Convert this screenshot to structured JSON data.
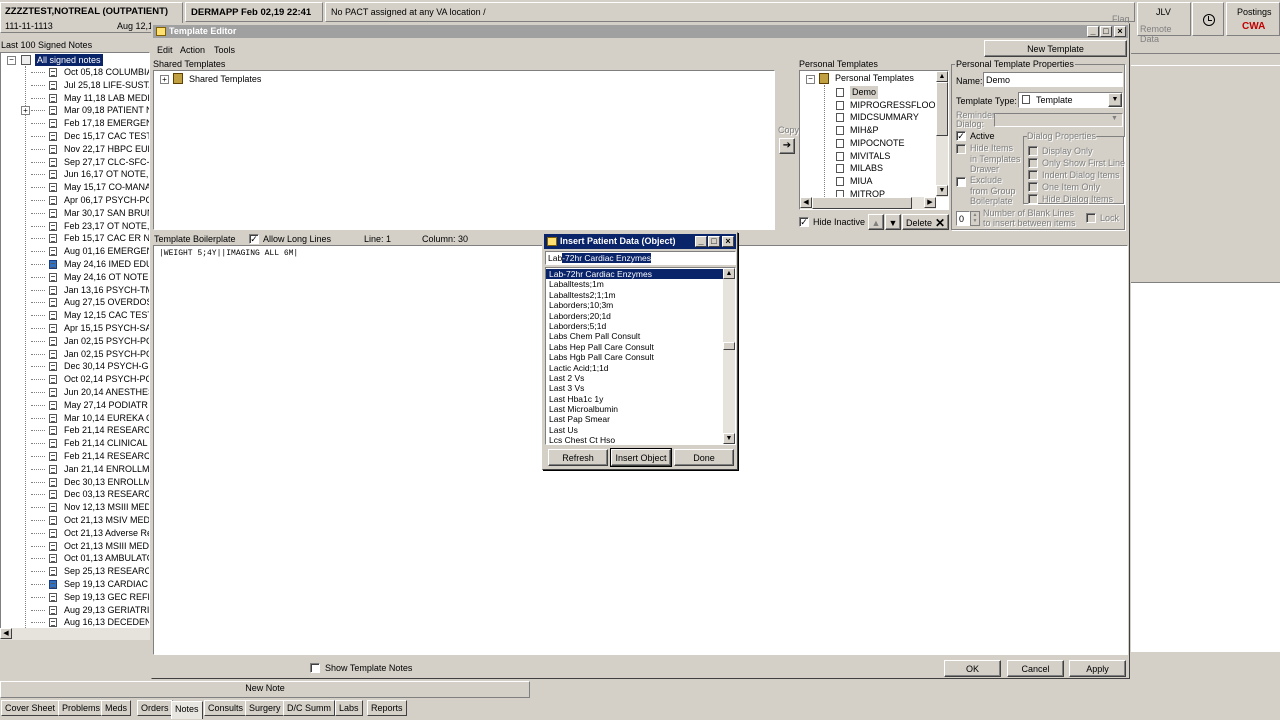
{
  "header": {
    "patient_name": "ZZZZTEST,NOTREAL (OUTPATIENT)",
    "patient_id": "111-11-1113",
    "patient_dob": "Aug 12,1",
    "location": "DERMAPP Feb 02,19 22:41",
    "pact": "No PACT assigned at any VA location /",
    "flag": "Flag",
    "jlv": "JLV",
    "remote_data": "Remote Data",
    "postings": "Postings",
    "cwa": "CWA"
  },
  "notes_panel": {
    "title": "Last 100 Signed Notes",
    "root": "All signed notes",
    "new_note_button": "New Note",
    "items": [
      {
        "text": "Oct 05,18 COLUMBIA",
        "icon": "doc"
      },
      {
        "text": "Jul 25,18 LIFE-SUSTA",
        "icon": "doc"
      },
      {
        "text": "May 11,18 LAB MEDI",
        "icon": "doc"
      },
      {
        "text": "Mar 09,18 PATIENT N",
        "icon": "group"
      },
      {
        "text": "Feb 17,18 EMERGEN",
        "icon": "doc"
      },
      {
        "text": "Dec 15,17 CAC TEST",
        "icon": "doc"
      },
      {
        "text": "Nov 22,17 HBPC EUF",
        "icon": "doc"
      },
      {
        "text": "Sep 27,17 CLC-SFC-F",
        "icon": "doc"
      },
      {
        "text": "Jun 16,17 OT NOTE,",
        "icon": "doc"
      },
      {
        "text": "May 15,17 CO-MANA",
        "icon": "doc"
      },
      {
        "text": "Apr 06,17 PSYCH-PC",
        "icon": "doc"
      },
      {
        "text": "Mar 30,17 SAN BRUN",
        "icon": "doc"
      },
      {
        "text": "Feb 23,17 OT NOTE,",
        "icon": "doc"
      },
      {
        "text": "Feb 15,17 CAC ER NU",
        "icon": "doc"
      },
      {
        "text": "Aug 01,16 EMERGEN",
        "icon": "doc"
      },
      {
        "text": "May 24,16 IMED EDU",
        "icon": "blue"
      },
      {
        "text": "May 24,16 OT NOTE,",
        "icon": "doc"
      },
      {
        "text": "Jan 13,16 PSYCH-TM",
        "icon": "doc"
      },
      {
        "text": "Aug 27,15 OVERDOS",
        "icon": "doc"
      },
      {
        "text": "May 12,15 CAC TEST",
        "icon": "doc"
      },
      {
        "text": "Apr 15,15 PSYCH-SA",
        "icon": "doc"
      },
      {
        "text": "Jan 02,15 PSYCH-PC",
        "icon": "doc"
      },
      {
        "text": "Jan 02,15 PSYCH-PC",
        "icon": "doc"
      },
      {
        "text": "Dec 30,14 PSYCH-GF",
        "icon": "doc"
      },
      {
        "text": "Oct 02,14 PSYCH-PC",
        "icon": "doc"
      },
      {
        "text": "Jun 20,14 ANESTHES",
        "icon": "doc"
      },
      {
        "text": "May 27,14 PODIATR",
        "icon": "doc"
      },
      {
        "text": "Mar 10,14 EUREKA C",
        "icon": "doc"
      },
      {
        "text": "Feb 21,14 RESEARCI",
        "icon": "doc"
      },
      {
        "text": "Feb 21,14 CLINICAL I",
        "icon": "doc"
      },
      {
        "text": "Feb 21,14 RESEARCI",
        "icon": "doc"
      },
      {
        "text": "Jan 21,14 ENROLLMI",
        "icon": "doc"
      },
      {
        "text": "Dec 30,13 ENROLLM",
        "icon": "doc"
      },
      {
        "text": "Dec 03,13 RESEARC",
        "icon": "doc"
      },
      {
        "text": "Nov 12,13 MSIII MED",
        "icon": "doc"
      },
      {
        "text": "Oct 21,13 MSIV MED",
        "icon": "doc"
      },
      {
        "text": "Oct 21,13 Adverse Re",
        "icon": "doc"
      },
      {
        "text": "Oct 21,13 MSIII MEDI",
        "icon": "doc"
      },
      {
        "text": "Oct 01,13 AMBULATO",
        "icon": "doc"
      },
      {
        "text": "Sep 25,13 RESEARC",
        "icon": "doc"
      },
      {
        "text": "Sep 19,13 CARDIAC (",
        "icon": "blue"
      },
      {
        "text": "Sep 19,13 GEC REFE",
        "icon": "doc"
      },
      {
        "text": "Aug 29,13 GERIATRI",
        "icon": "doc"
      },
      {
        "text": "Aug 16,13 DECEDEN",
        "icon": "doc"
      }
    ]
  },
  "tabs": [
    "Cover Sheet",
    "Problems",
    "Meds",
    "Orders",
    "Notes",
    "Consults",
    "Surgery",
    "D/C Summ",
    "Labs",
    "Reports"
  ],
  "template_editor": {
    "title": "Template Editor",
    "menu": [
      "Edit",
      "Action",
      "Tools"
    ],
    "new_template_button": "New Template",
    "shared_label": "Shared Templates",
    "shared_root": "Shared Templates",
    "personal_label": "Personal Templates",
    "personal_root": "Personal Templates",
    "personal_items": [
      "Demo",
      "MIPROGRESSFLOOR",
      "MIDCSUMMARY",
      "MIH&P",
      "MIPOCNOTE",
      "MIVITALS",
      "MILABS",
      "MIUA",
      "MITROP"
    ],
    "copy_label": "Copy",
    "hide_inactive": "Hide Inactive",
    "delete_button": "Delete",
    "properties": {
      "group_title": "Personal Template Properties",
      "name_label": "Name:",
      "name_value": "Demo",
      "type_label": "Template Type:",
      "type_value": "Template",
      "reminder_label": "Reminder Dialog:",
      "active_label": "Active",
      "hide_items_label": "Hide Items in Templates Drawer",
      "exclude_label": "Exclude from Group Boilerplate",
      "dialog_props_title": "Dialog Properties",
      "display_only": "Display Only",
      "only_show_first": "Only Show First Line",
      "indent_items": "Indent Dialog Items",
      "one_item_only": "One Item Only",
      "hide_dialog_items": "Hide Dialog Items",
      "blank_lines_value": "0",
      "blank_lines_label": "Number of Blank Lines to insert between items",
      "lock_label": "Lock"
    },
    "boilerplate": {
      "label": "Template Boilerplate",
      "allow_long_lines": "Allow Long Lines",
      "line": "Line: 1",
      "column": "Column: 30",
      "text": "|WEIGHT 5;4Y||IMAGING ALL 6M|"
    },
    "show_notes": "Show Template Notes",
    "ok_button": "OK",
    "cancel_button": "Cancel",
    "apply_button": "Apply"
  },
  "insert_dialog": {
    "title": "Insert Patient Data (Object)",
    "search_prefix": "Lab",
    "search_selected": "-72hr Cardiac Enzymes",
    "items": [
      "Lab-72hr Cardiac Enzymes",
      "Laballtests;1m",
      "Laballtests2;1;1m",
      "Laborders;10;3m",
      "Laborders;20;1d",
      "Laborders;5;1d",
      "Labs Chem Pall Consult",
      "Labs Hep Pall Care Consult",
      "Labs Hgb Pall Care Consult",
      "Lactic Acid;1;1d",
      "Last 2 Vs",
      "Last 3 Vs",
      "Last Hba1c 1y",
      "Last Microalbumin",
      "Last Pap Smear",
      "Last Us",
      "Lcs Chest Ct Hso"
    ],
    "selected_index": 0,
    "refresh_button": "Refresh",
    "insert_button": "Insert Object",
    "done_button": "Done"
  }
}
